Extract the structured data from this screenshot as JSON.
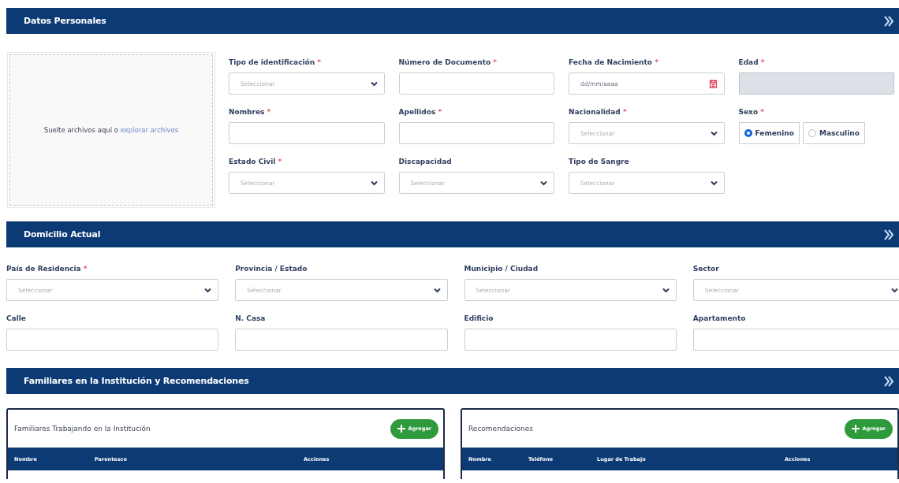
{
  "personal": {
    "title": "Datos Personales",
    "upload": {
      "text": "Suelte archivos aquí o",
      "link": "explorar archivos"
    },
    "fields": [
      {
        "kind": "select",
        "label": "Tipo de identificación",
        "mark": "*",
        "placeholder": "Seleccionar"
      },
      {
        "kind": "text",
        "label": "Número de Documento",
        "mark": "*"
      },
      {
        "kind": "date",
        "label": "Fecha de Nacimiento",
        "mark": "*",
        "placeholder": "dd/mm/aaaa"
      },
      {
        "kind": "text",
        "label": "Edad",
        "mark": "*",
        "disabled": true
      },
      {
        "kind": "text",
        "label": "Nombres",
        "mark": "*",
        "disabled": false
      },
      {
        "kind": "text",
        "label": "Apellidos",
        "mark": "*",
        "disabled": false
      },
      {
        "kind": "select",
        "label": "Nacionalidad",
        "mark": "*",
        "placeholder": "Seleccionar"
      },
      {
        "kind": "radio",
        "label": "Sexo",
        "mark": "*",
        "options": [
          {
            "label": "Femenino",
            "selected": true
          },
          {
            "label": "Masculino",
            "selected": false
          }
        ]
      },
      {
        "kind": "select",
        "label": "Estado Civil",
        "mark": "*",
        "placeholder": "Seleccionar"
      },
      {
        "kind": "select",
        "label": "Discapacidad",
        "placeholder": "Seleccionar"
      },
      {
        "kind": "select",
        "label": "Tipo de Sangre",
        "placeholder": "Seleccionar"
      }
    ]
  },
  "address": {
    "title": "Domicilio Actual",
    "fields": [
      {
        "kind": "select",
        "label": "País de Residencia",
        "mark": "*",
        "placeholder": "Seleccionar"
      },
      {
        "kind": "select",
        "label": "Provincia / Estado",
        "placeholder": "Seleccionar"
      },
      {
        "kind": "select",
        "label": "Municipio / Ciudad",
        "placeholder": "Seleccionar"
      },
      {
        "kind": "select",
        "label": "Sector",
        "placeholder": "Seleccionar"
      },
      {
        "kind": "text",
        "label": "Calle"
      },
      {
        "kind": "text",
        "label": "N. Casa"
      },
      {
        "kind": "text",
        "label": "Edificio"
      },
      {
        "kind": "text",
        "label": "Apartamento"
      }
    ]
  },
  "family": {
    "title": "Familiares en la Institución y Recomendaciones",
    "panels": [
      {
        "title": "Familiares Trabajando en la Institución",
        "button": "Agregar",
        "columns": [
          "Nombre",
          "Parentesco",
          "Acciones"
        ]
      },
      {
        "title": "Recomendaciones",
        "button": "Agregar",
        "columns": [
          "Nombre",
          "Teléfono",
          "Lugar de Trabajo",
          "Acciones"
        ]
      }
    ]
  }
}
